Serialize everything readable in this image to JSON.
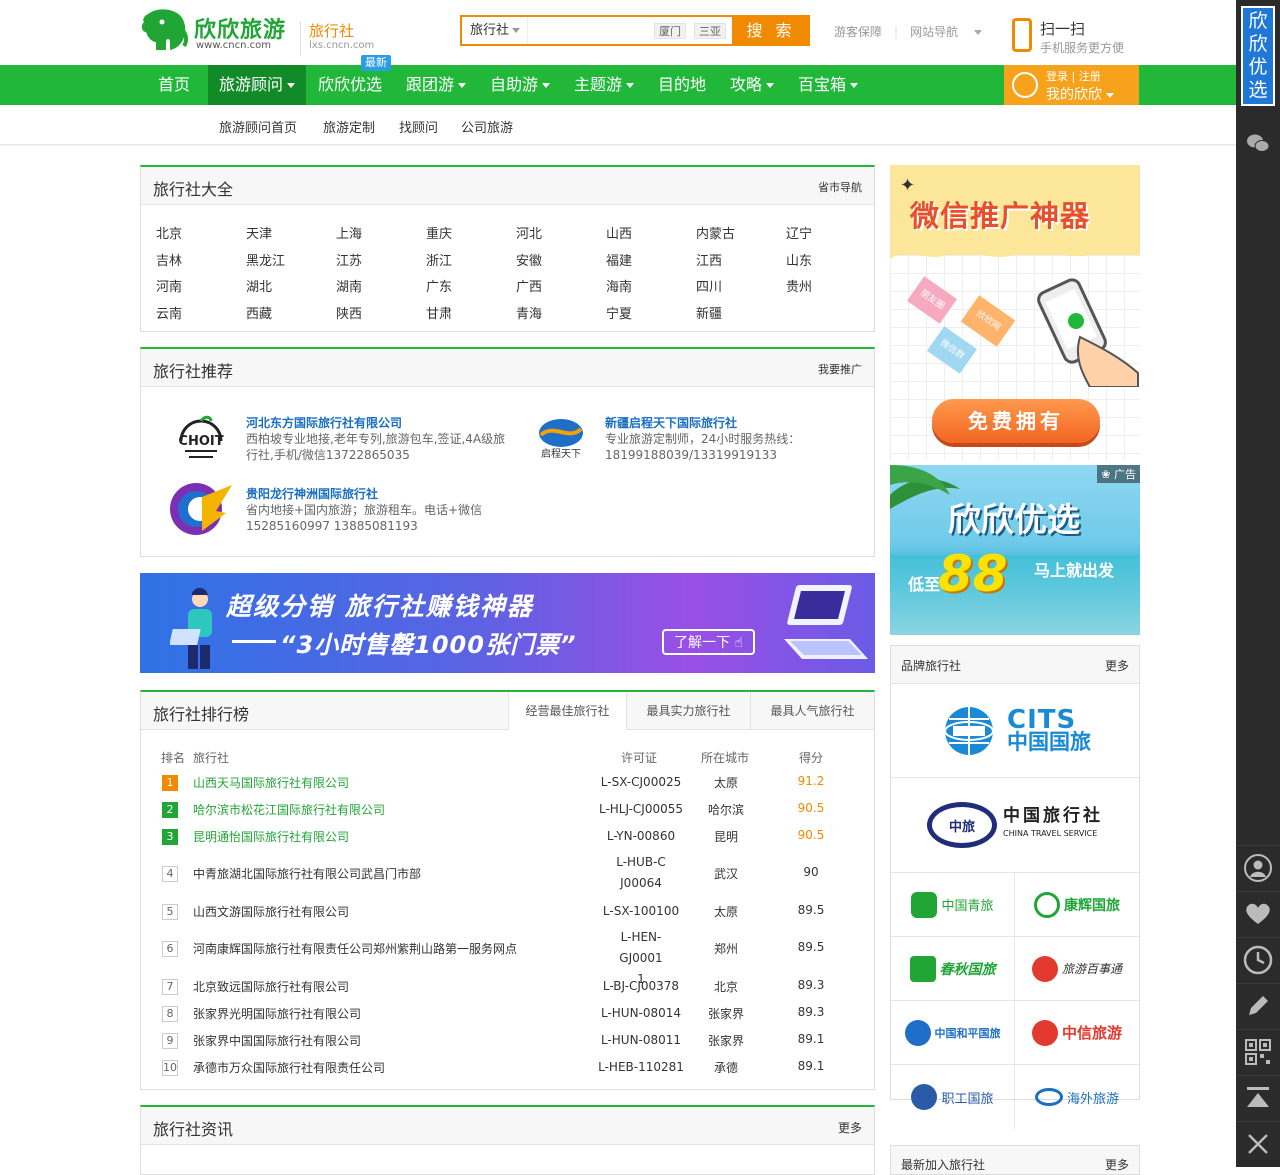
{
  "header": {
    "logo_text": "欣欣旅游",
    "logo_url_text": "www.cncn.com",
    "subsite_name": "旅行社",
    "subsite_domain": "lxs.cncn.com",
    "search_type": "旅行社",
    "search_value": "",
    "search_keywords": [
      "厦门",
      "三亚"
    ],
    "search_button": "搜 索",
    "link_guarantee": "游客保障",
    "link_sitenav": "网站导航",
    "scan_title": "扫一扫",
    "scan_sub": "手机服务更方便"
  },
  "nav": {
    "items": [
      "首页",
      "旅游顾问",
      "欣欣优选",
      "跟团游",
      "自助游",
      "主题游",
      "目的地",
      "攻略",
      "百宝箱"
    ],
    "new_badge": "最新",
    "login_text": "登录 | 注册",
    "my_text": "我的欣欣"
  },
  "subnav": [
    "旅游顾问首页",
    "旅游定制",
    "找顾问",
    "公司旅游"
  ],
  "agencies_panel": {
    "title": "旅行社大全",
    "more": "省市导航",
    "provinces": [
      "北京",
      "天津",
      "上海",
      "重庆",
      "河北",
      "山西",
      "内蒙古",
      "辽宁",
      "吉林",
      "黑龙江",
      "江苏",
      "浙江",
      "安徽",
      "福建",
      "江西",
      "山东",
      "河南",
      "湖北",
      "湖南",
      "广东",
      "广西",
      "海南",
      "四川",
      "贵州",
      "云南",
      "西藏",
      "陕西",
      "甘肃",
      "青海",
      "宁夏",
      "新疆"
    ]
  },
  "recommend_panel": {
    "title": "旅行社推荐",
    "more": "我要推广",
    "items": [
      {
        "name": "河北东方国际旅行社有限公司",
        "desc": "西柏坡专业地接,老年专列,旅游包车,签证,4A级旅行社,手机/微信13722865035",
        "logo_text": "CHOIT"
      },
      {
        "name": "新疆启程天下国际旅行社",
        "desc": "专业旅游定制师，24小时服务热线：18199188039/13319919133",
        "logo_text": "启程天下"
      },
      {
        "name": "贵阳龙行神洲国际旅行社",
        "desc": "省内地接+国内旅游；旅游租车。电话+微信15285160997 13885081193",
        "logo_text": ""
      }
    ]
  },
  "banner": {
    "line1": "超级分销   旅行社赚钱神器",
    "line2": "“3小时售罄1000张门票”",
    "button": "了解一下"
  },
  "ranking": {
    "title": "旅行社排行榜",
    "tabs": [
      "经营最佳旅行社",
      "最具实力旅行社",
      "最具人气旅行社"
    ],
    "headers": {
      "rank": "排名",
      "name": "旅行社",
      "license": "许可证",
      "city": "所在城市",
      "score": "得分"
    },
    "rows": [
      {
        "rank": "1",
        "name": "山西天马国际旅行社有限公司",
        "license": "L-SX-CJ00025",
        "city": "太原",
        "score": "91.2"
      },
      {
        "rank": "2",
        "name": "哈尔滨市松花江国际旅行社有限公司",
        "license": "L-HLJ-CJ00055",
        "city": "哈尔滨",
        "score": "90.5"
      },
      {
        "rank": "3",
        "name": "昆明通怡国际旅行社有限公司",
        "license": "L-YN-00860",
        "city": "昆明",
        "score": "90.5"
      },
      {
        "rank": "4",
        "name": "中青旅湖北国际旅行社有限公司武昌门市部",
        "license": "L-HUB-CJ00064",
        "city": "武汉",
        "score": "90"
      },
      {
        "rank": "5",
        "name": "山西文游国际旅行社有限公司",
        "license": "L-SX-100100",
        "city": "太原",
        "score": "89.5"
      },
      {
        "rank": "6",
        "name": "河南康辉国际旅行社有限责任公司郑州紫荆山路第一服务网点",
        "license": "L-HEN-GJ00011",
        "city": "郑州",
        "score": "89.5"
      },
      {
        "rank": "7",
        "name": "北京致远国际旅行社有限公司",
        "license": "L-BJ-CJ00378",
        "city": "北京",
        "score": "89.3"
      },
      {
        "rank": "8",
        "name": "张家界光明国际旅行社有限公司",
        "license": "L-HUN-08014",
        "city": "张家界",
        "score": "89.3"
      },
      {
        "rank": "9",
        "name": "张家界中国国际旅行社有限公司",
        "license": "L-HUN-08011",
        "city": "张家界",
        "score": "89.1"
      },
      {
        "rank": "10",
        "name": "承德市万众国际旅行社有限责任公司",
        "license": "L-HEB-110281",
        "city": "承德",
        "score": "89.1"
      }
    ]
  },
  "news_panel": {
    "title": "旅行社资讯",
    "more": "更多"
  },
  "ad_wechat": {
    "title": "微信推广神器",
    "button": "免费拥有",
    "tags": [
      "朋友圈",
      "欣欣网",
      "微信群"
    ]
  },
  "ad_youxuan": {
    "tag": "广告",
    "title": "欣欣优选",
    "low": "低至",
    "price": "88",
    "go": "马上就出发"
  },
  "brand_panel": {
    "title": "品牌旅行社",
    "more": "更多",
    "cits_en": "CITS",
    "cits_cn": "中国国旅",
    "cts_cn": "中国旅行社",
    "cts_en": "CHINA TRAVEL SERVICE",
    "cts_badge": "中旅",
    "small": [
      "中国青旅",
      "康辉国旅",
      "春秋国旅",
      "旅游百事通",
      "中国和平国旅",
      "中信旅游",
      "职工国旅",
      "海外旅游"
    ]
  },
  "new_agencies": {
    "title": "最新加入旅行社",
    "more": "更多"
  },
  "sidebar": {
    "title": "欣欣优选"
  },
  "colors": {
    "green": "#21b83a",
    "orange": "#f08a00",
    "link_blue": "#1a6fc1"
  }
}
